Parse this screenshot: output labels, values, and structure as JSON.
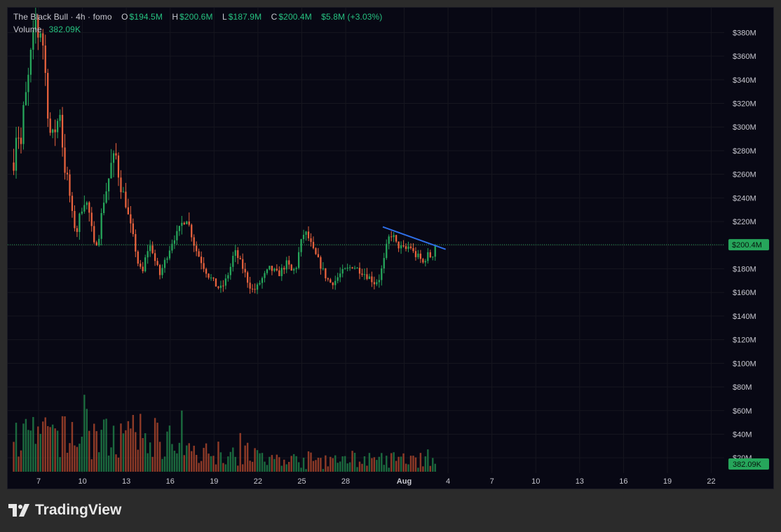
{
  "legend": {
    "symbol": "The Black Bull · 4h · fomo",
    "o_key": "O",
    "o_val": "$194.5M",
    "h_key": "H",
    "h_val": "$200.6M",
    "l_key": "L",
    "l_val": "$187.9M",
    "c_key": "C",
    "c_val": "$200.4M",
    "change": "$5.8M (+3.03%)",
    "volume_key": "Volume",
    "volume_val": "382.09K"
  },
  "brand": {
    "name": "TradingView"
  },
  "colors": {
    "up": "#26a65b",
    "down": "#e8623d",
    "background": "#080814",
    "grid": "#16161f",
    "accent_price": "#26a65b",
    "trendline": "#2f6fe8",
    "axis_text": "#c8c8d0"
  },
  "chart_data": {
    "type": "candlestick",
    "timeframe": "4h",
    "y_axis": {
      "ticks": [
        20,
        40,
        60,
        80,
        100,
        120,
        140,
        160,
        180,
        200,
        220,
        240,
        260,
        280,
        300,
        320,
        340,
        360,
        380
      ],
      "tick_labels": [
        "$20M",
        "$40M",
        "$60M",
        "$80M",
        "$100M",
        "$120M",
        "$140M",
        "$160M",
        "$180M",
        "$200M",
        "$220M",
        "$240M",
        "$260M",
        "$280M",
        "$300M",
        "$320M",
        "$340M",
        "$360M",
        "$380M"
      ],
      "ylim": [
        0,
        400
      ],
      "unit": "$M"
    },
    "x_axis": {
      "tick_labels": [
        "7",
        "10",
        "13",
        "16",
        "19",
        "22",
        "25",
        "28",
        "Aug",
        "4",
        "7",
        "10",
        "13",
        "16",
        "19",
        "22"
      ],
      "xlim_days": [
        5.3,
        28.4
      ]
    },
    "current_price_label": "$200.4M",
    "current_price": 200.4,
    "current_volume_label": "382.09K",
    "price_anchors": [
      [
        5.3,
        270
      ],
      [
        5.5,
        300
      ],
      [
        5.8,
        285
      ],
      [
        6.0,
        320
      ],
      [
        6.2,
        330
      ],
      [
        6.5,
        365
      ],
      [
        6.8,
        390
      ],
      [
        7.0,
        375
      ],
      [
        7.2,
        385
      ],
      [
        7.5,
        340
      ],
      [
        7.7,
        300
      ],
      [
        7.9,
        290
      ],
      [
        8.2,
        300
      ],
      [
        8.5,
        315
      ],
      [
        8.7,
        270
      ],
      [
        9.0,
        255
      ],
      [
        9.3,
        225
      ],
      [
        9.6,
        210
      ],
      [
        9.9,
        230
      ],
      [
        10.2,
        240
      ],
      [
        10.5,
        225
      ],
      [
        10.8,
        200
      ],
      [
        11.1,
        205
      ],
      [
        11.4,
        235
      ],
      [
        11.7,
        250
      ],
      [
        12.0,
        270
      ],
      [
        12.3,
        275
      ],
      [
        12.6,
        250
      ],
      [
        12.9,
        240
      ],
      [
        13.2,
        220
      ],
      [
        13.5,
        205
      ],
      [
        13.8,
        185
      ],
      [
        14.1,
        175
      ],
      [
        14.4,
        195
      ],
      [
        14.7,
        200
      ],
      [
        15.0,
        185
      ],
      [
        15.3,
        175
      ],
      [
        15.6,
        185
      ],
      [
        15.9,
        195
      ],
      [
        16.2,
        205
      ],
      [
        16.5,
        210
      ],
      [
        16.8,
        218
      ],
      [
        17.1,
        225
      ],
      [
        17.4,
        212
      ],
      [
        17.7,
        198
      ],
      [
        18.0,
        190
      ],
      [
        18.3,
        182
      ],
      [
        18.6,
        175
      ],
      [
        18.9,
        170
      ],
      [
        19.2,
        165
      ],
      [
        19.5,
        163
      ],
      [
        19.8,
        170
      ],
      [
        20.1,
        180
      ],
      [
        20.4,
        195
      ],
      [
        20.7,
        188
      ],
      [
        21.0,
        180
      ],
      [
        21.3,
        170
      ],
      [
        21.6,
        162
      ],
      [
        21.9,
        163
      ],
      [
        22.2,
        170
      ],
      [
        22.5,
        175
      ],
      [
        22.8,
        180
      ],
      [
        23.1,
        178
      ],
      [
        23.4,
        175
      ],
      [
        23.7,
        180
      ],
      [
        24.0,
        185
      ],
      [
        24.3,
        178
      ],
      [
        24.6,
        180
      ],
      [
        24.9,
        200
      ],
      [
        25.2,
        212
      ],
      [
        25.5,
        205
      ],
      [
        25.8,
        195
      ],
      [
        26.1,
        188
      ],
      [
        26.4,
        180
      ],
      [
        26.7,
        172
      ],
      [
        27.0,
        168
      ],
      [
        27.3,
        170
      ],
      [
        27.6,
        175
      ],
      [
        27.9,
        178
      ],
      [
        28.2,
        180
      ],
      [
        28.5,
        183
      ],
      [
        28.8,
        180
      ],
      [
        29.1,
        178
      ],
      [
        29.4,
        175
      ],
      [
        29.7,
        172
      ],
      [
        30.0,
        168
      ],
      [
        30.3,
        172
      ],
      [
        30.6,
        185
      ],
      [
        30.9,
        205
      ],
      [
        31.2,
        210
      ],
      [
        31.5,
        200
      ],
      [
        31.8,
        198
      ],
      [
        32.1,
        196
      ],
      [
        32.4,
        200
      ],
      [
        32.7,
        192
      ],
      [
        33.0,
        190
      ],
      [
        33.3,
        185
      ],
      [
        33.6,
        192
      ],
      [
        33.9,
        190
      ],
      [
        34.2,
        200.4
      ]
    ],
    "trendline": {
      "from": [
        30.55,
        215.5
      ],
      "to": [
        34.85,
        196.5
      ]
    },
    "volume_scale_max": 110
  }
}
